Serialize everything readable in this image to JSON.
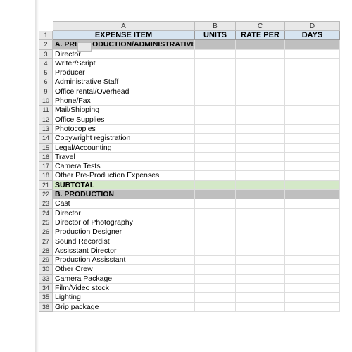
{
  "columns": {
    "a": "A",
    "b": "B",
    "c": "C",
    "d": "D"
  },
  "headers": {
    "expense_item": "EXPENSE ITEM",
    "units": "UNITS",
    "rate_per": "RATE PER",
    "days": "DAYS"
  },
  "rows": [
    {
      "num": "1",
      "type": "header"
    },
    {
      "num": "2",
      "type": "section",
      "a": "A. PRE-PRODUCTION/ADMINISTRATIVE"
    },
    {
      "num": "3",
      "type": "item",
      "a": "Director"
    },
    {
      "num": "4",
      "type": "item",
      "a": "Writer/Script"
    },
    {
      "num": "5",
      "type": "item",
      "a": "Producer"
    },
    {
      "num": "6",
      "type": "item",
      "a": "Administrative Staff"
    },
    {
      "num": "9",
      "type": "item",
      "a": "Office rental/Overhead"
    },
    {
      "num": "10",
      "type": "item",
      "a": "Phone/Fax"
    },
    {
      "num": "11",
      "type": "item",
      "a": "Mail/Shipping"
    },
    {
      "num": "12",
      "type": "item",
      "a": "Office Supplies"
    },
    {
      "num": "13",
      "type": "item",
      "a": "Photocopies"
    },
    {
      "num": "14",
      "type": "item",
      "a": "Copywright registration"
    },
    {
      "num": "15",
      "type": "item",
      "a": "Legal/Accounting"
    },
    {
      "num": "16",
      "type": "item",
      "a": "Travel"
    },
    {
      "num": "17",
      "type": "item",
      "a": "Camera Tests"
    },
    {
      "num": "18",
      "type": "item",
      "a": "Other Pre-Production Expenses"
    },
    {
      "num": "21",
      "type": "subtotal",
      "a": "SUBTOTAL"
    },
    {
      "num": "22",
      "type": "section",
      "a": "B. PRODUCTION"
    },
    {
      "num": "23",
      "type": "item",
      "a": "Cast"
    },
    {
      "num": "24",
      "type": "item",
      "a": "Director"
    },
    {
      "num": "25",
      "type": "item",
      "a": "Director of Photography"
    },
    {
      "num": "26",
      "type": "item",
      "a": "Production Designer"
    },
    {
      "num": "27",
      "type": "item",
      "a": "Sound Recordist"
    },
    {
      "num": "28",
      "type": "item",
      "a": "Assisstant Director"
    },
    {
      "num": "29",
      "type": "item",
      "a": "Production Assisstant"
    },
    {
      "num": "30",
      "type": "item",
      "a": "Other Crew"
    },
    {
      "num": "33",
      "type": "item",
      "a": "Camera Package"
    },
    {
      "num": "34",
      "type": "item",
      "a": "Film/Video stock"
    },
    {
      "num": "35",
      "type": "item",
      "a": "Lighting"
    },
    {
      "num": "36",
      "type": "item",
      "a": "Grip package"
    }
  ]
}
